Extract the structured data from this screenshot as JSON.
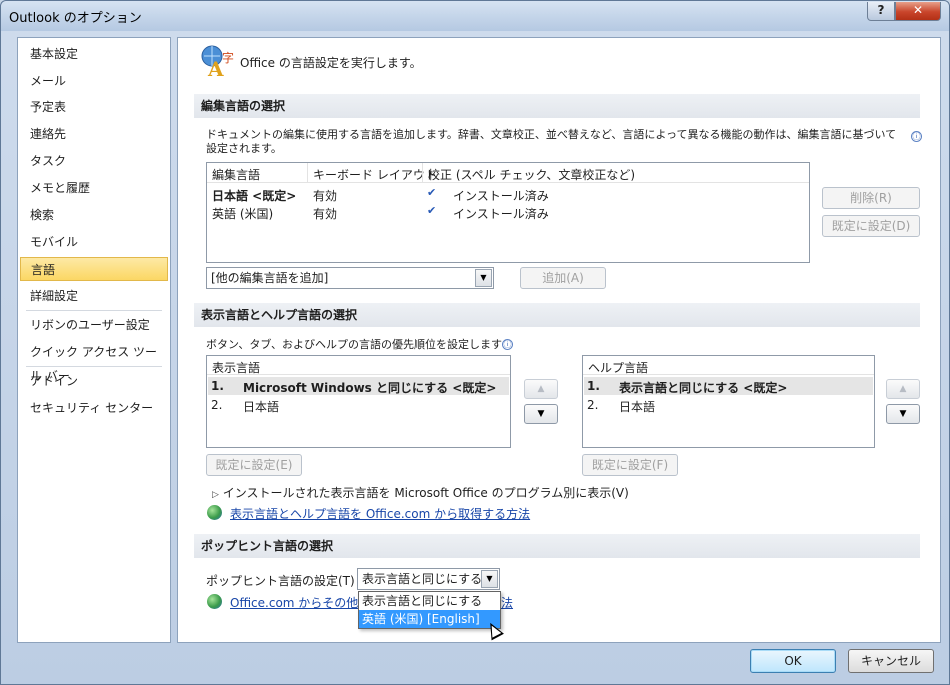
{
  "window": {
    "title": "Outlook のオプション",
    "help_label": "?",
    "close_label": "✕"
  },
  "nav": {
    "items": [
      "基本設定",
      "メール",
      "予定表",
      "連絡先",
      "タスク",
      "メモと履歴",
      "検索",
      "モバイル",
      "言語",
      "詳細設定",
      "リボンのユーザー設定",
      "クイック アクセス ツール バー",
      "アドイン",
      "セキュリティ センター"
    ],
    "selected": "言語"
  },
  "header": {
    "text": "Office の言語設定を実行します。"
  },
  "editing": {
    "section_title": "編集言語の選択",
    "description": "ドキュメントの編集に使用する言語を追加します。辞書、文章校正、並べ替えなど、言語によって異なる機能の動作は、編集言語に基づいて設定されます。",
    "info_icon": "ⓘ",
    "columns": [
      "編集言語",
      "キーボード レイアウト",
      "校正 (スペル チェック、文章校正など)"
    ],
    "rows": [
      {
        "lang": "日本語 <既定>",
        "keyboard": "有効",
        "proofing": "インストール済み"
      },
      {
        "lang": "英語 (米国)",
        "keyboard": "有効",
        "proofing": "インストール済み"
      }
    ],
    "delete_label": "削除(R)",
    "set_default_label": "既定に設定(D)",
    "add_combo_value": "[他の編集言語を追加]",
    "add_label": "追加(A)"
  },
  "display": {
    "section_title": "表示言語とヘルプ言語の選択",
    "description": "ボタン、タブ、およびヘルプの言語の優先順位を設定します",
    "display_header": "表示言語",
    "display_items": [
      {
        "num": "1.",
        "label": "Microsoft Windows と同じにする <既定>"
      },
      {
        "num": "2.",
        "label": "日本語"
      }
    ],
    "help_header": "ヘルプ言語",
    "help_items": [
      {
        "num": "1.",
        "label": "表示言語と同じにする <既定>"
      },
      {
        "num": "2.",
        "label": "日本語"
      }
    ],
    "up_arrow": "▲",
    "down_arrow": "▼",
    "set_default_label": "既定に設定(E)",
    "set_default_help_label": "既定に設定(F)",
    "expand_glyph": "▷",
    "show_installed": "インストールされた表示言語を Microsoft Office のプログラム別に表示(V)",
    "link": "表示言語とヘルプ言語を Office.com から取得する方法"
  },
  "popup": {
    "section_title": "ポップヒント言語の選択",
    "label": "ポップヒント言語の設定(T)",
    "combo_value": "表示言語と同じにする",
    "link": "Office.com からその他の",
    "link_tail": "法",
    "options": [
      "表示言語と同じにする",
      "英語 (米国) [English]"
    ],
    "selected_option": "英語 (米国) [English]"
  },
  "footer": {
    "ok_label": "OK",
    "cancel_label": "キャンセル"
  },
  "colors": {
    "selected_nav": "#fbd764",
    "link": "#1846a8",
    "highlight": "#3399ff"
  }
}
